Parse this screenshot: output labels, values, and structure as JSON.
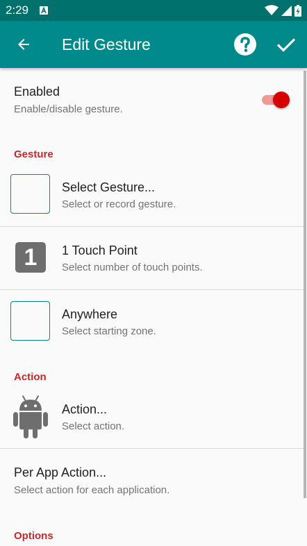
{
  "status_bar": {
    "time": "2:29"
  },
  "app_bar": {
    "title": "Edit Gesture"
  },
  "enabled": {
    "title": "Enabled",
    "summary": "Enable/disable gesture.",
    "on": true
  },
  "sections": {
    "gesture": "Gesture",
    "action": "Action",
    "options": "Options"
  },
  "gesture_rows": {
    "select_gesture": {
      "title": "Select Gesture...",
      "summary": "Select or record gesture."
    },
    "touch_points": {
      "icon_value": "1",
      "title": "1 Touch Point",
      "summary": "Select number of touch points."
    },
    "starting_zone": {
      "title": "Anywhere",
      "summary": "Select starting zone."
    }
  },
  "action_rows": {
    "action": {
      "title": "Action...",
      "summary": "Select action."
    },
    "per_app_action": {
      "title": "Per App Action...",
      "summary": "Select action for each application."
    }
  },
  "colors": {
    "status_bar": "#00706c",
    "app_bar": "#00898a",
    "section_header": "#c62828",
    "switch_thumb": "#d50000",
    "switch_track": "#ee9a9a"
  }
}
